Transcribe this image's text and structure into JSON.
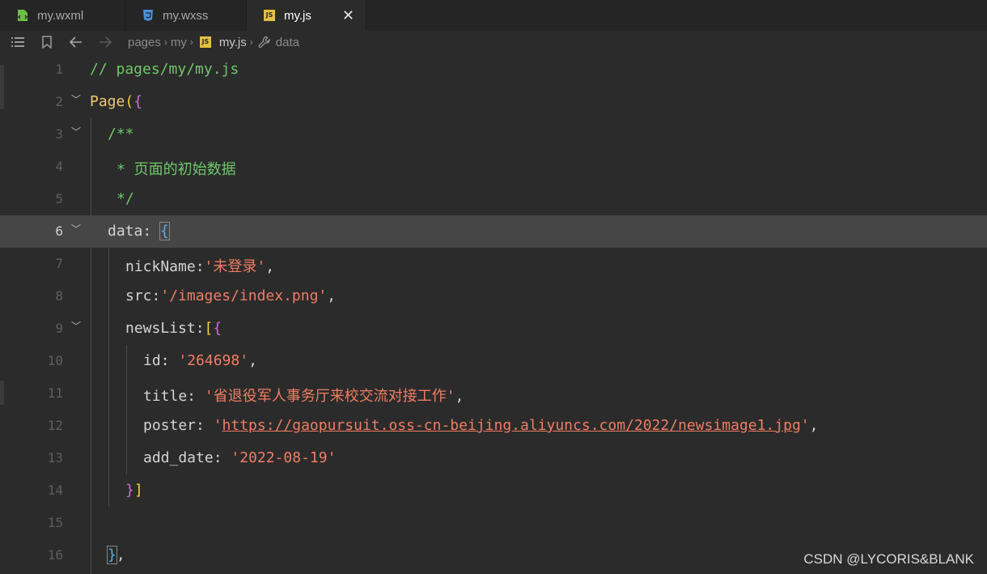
{
  "tabs": [
    {
      "label": "my.wxml",
      "icon": "wxml-file-icon",
      "active": false
    },
    {
      "label": "my.wxss",
      "icon": "css-file-icon",
      "active": false
    },
    {
      "label": "my.js",
      "icon": "js-file-icon",
      "active": true
    }
  ],
  "breadcrumb": {
    "items": [
      "pages",
      "my",
      "my.js",
      "data"
    ]
  },
  "editor": {
    "lines": [
      {
        "num": "1"
      },
      {
        "num": "2"
      },
      {
        "num": "3"
      },
      {
        "num": "4"
      },
      {
        "num": "5"
      },
      {
        "num": "6"
      },
      {
        "num": "7"
      },
      {
        "num": "8"
      },
      {
        "num": "9"
      },
      {
        "num": "10"
      },
      {
        "num": "11"
      },
      {
        "num": "12"
      },
      {
        "num": "13"
      },
      {
        "num": "14"
      },
      {
        "num": "15"
      },
      {
        "num": "16"
      }
    ],
    "code": {
      "l1": "// pages/my/my.js",
      "l2_kw": "Page",
      "l2_open": "(",
      "l2_brace": "{",
      "l3": "/**",
      "l4": "* 页面的初始数据",
      "l5": "*/",
      "l6_key": "data",
      "l6_colon": ":",
      "l6_brace": "{",
      "l7_key": "nickName:",
      "l7_val": "'未登录'",
      "l7_end": ",",
      "l8_key": "src:",
      "l8_val": "'/images/index.png'",
      "l8_end": ",",
      "l9_key": "newsList:",
      "l9_br": "[",
      "l9_brace": "{",
      "l10_key": "id: ",
      "l10_val": "'264698'",
      "l10_end": ",",
      "l11_key": "title: ",
      "l11_val": "'省退役军人事务厅来校交流对接工作'",
      "l11_end": ",",
      "l12_key": "poster: ",
      "l12_q1": "'",
      "l12_url": "https://gaopursuit.oss-cn-beijing.aliyuncs.com/2022/newsimage1.jpg",
      "l12_q2": "'",
      "l12_end": ",",
      "l13_key": "add_date: ",
      "l13_val": "'2022-08-19'",
      "l14_brace": "}",
      "l14_br": "]",
      "l16_brace": "}",
      "l16_end": ","
    }
  },
  "watermark": "CSDN @LYCORIS&BLANK",
  "colors": {
    "background": "#2b2b2b",
    "comment": "#6fc76a",
    "string": "#f07d63",
    "keyword": "#f0c674",
    "highlight_line": "#464646"
  }
}
